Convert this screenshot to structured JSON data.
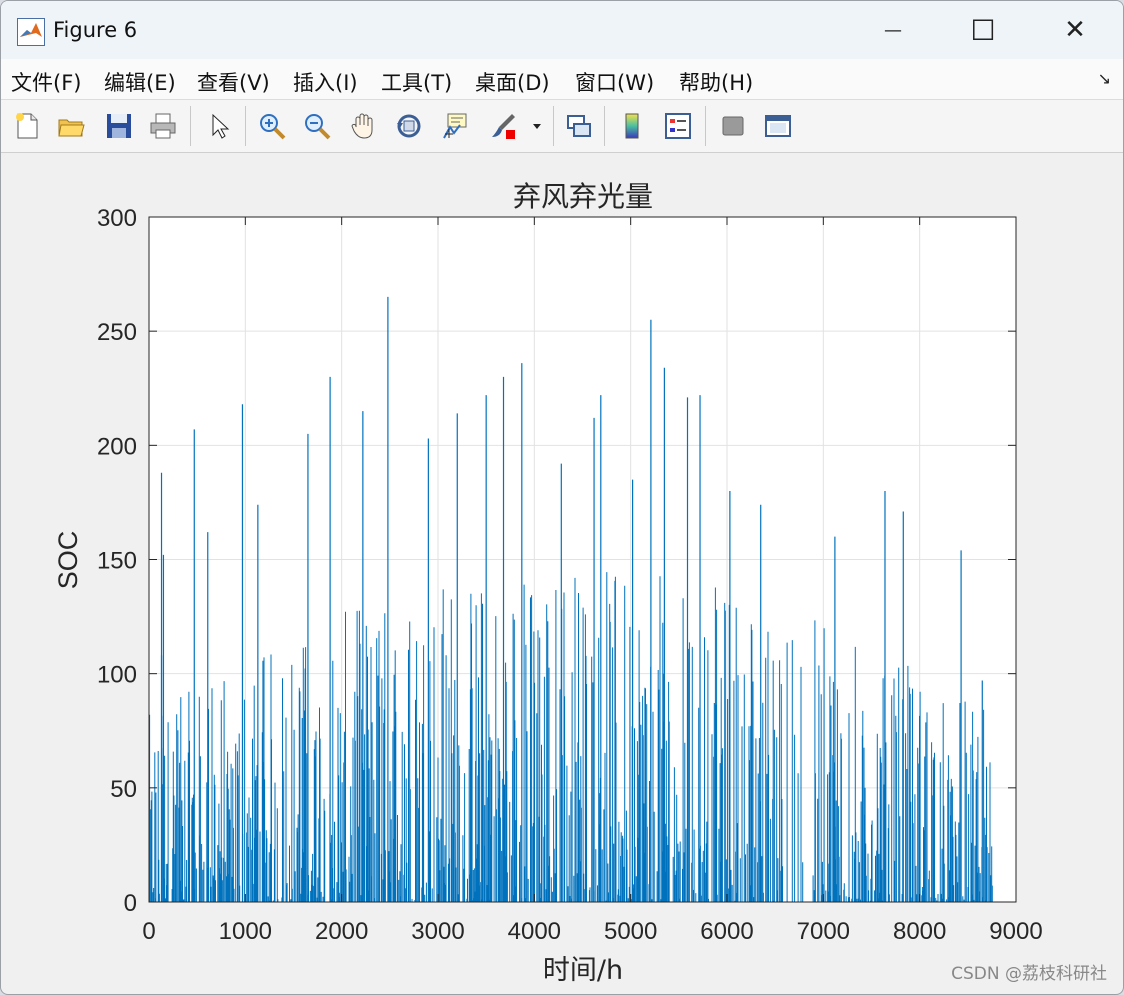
{
  "window": {
    "title": "Figure 6",
    "minimize_glyph": "—",
    "maximize_glyph": "☐",
    "close_glyph": "✕"
  },
  "menu": [
    {
      "label": "文件(F)"
    },
    {
      "label": "编辑(E)"
    },
    {
      "label": "查看(V)"
    },
    {
      "label": "插入(I)"
    },
    {
      "label": "工具(T)"
    },
    {
      "label": "桌面(D)"
    },
    {
      "label": "窗口(W)"
    },
    {
      "label": "帮助(H)"
    }
  ],
  "toolbar": {
    "icons": [
      "new-figure-icon",
      "open-folder-icon",
      "save-icon",
      "print-icon",
      "pointer-icon",
      "zoom-in-icon",
      "zoom-out-icon",
      "pan-hand-icon",
      "rotate-3d-icon",
      "data-cursor-icon",
      "brush-icon",
      "brush-dropdown-icon",
      "link-plot-icon",
      "colorbar-icon",
      "legend-icon",
      "hide-plot-tools-icon",
      "show-plot-tools-icon"
    ]
  },
  "colors": {
    "bar": "#0072BD",
    "grid": "#e2e2e2",
    "axes_bg": "#ffffff",
    "figure_bg": "#f0f0f0"
  },
  "watermark": "CSDN @荔枝科研社",
  "chart_data": {
    "type": "bar",
    "title": "弃风弃光量",
    "xlabel": "时间/h",
    "ylabel": "SOC",
    "xlim": [
      0,
      9000
    ],
    "ylim": [
      0,
      300
    ],
    "xticks": [
      0,
      1000,
      2000,
      3000,
      4000,
      5000,
      6000,
      7000,
      8000,
      9000
    ],
    "yticks": [
      0,
      50,
      100,
      150,
      200,
      250,
      300
    ],
    "grid": true,
    "n_points": 8760,
    "series": [
      {
        "color": "#0072BD",
        "peaks": [
          {
            "x": 130,
            "y": 108
          },
          {
            "x": 130,
            "y": 188
          },
          {
            "x": 150,
            "y": 152
          },
          {
            "x": 470,
            "y": 207
          },
          {
            "x": 610,
            "y": 162
          },
          {
            "x": 970,
            "y": 218
          },
          {
            "x": 1130,
            "y": 174
          },
          {
            "x": 1650,
            "y": 205
          },
          {
            "x": 1880,
            "y": 230
          },
          {
            "x": 2220,
            "y": 215
          },
          {
            "x": 2480,
            "y": 265
          },
          {
            "x": 2900,
            "y": 203
          },
          {
            "x": 3200,
            "y": 214
          },
          {
            "x": 3500,
            "y": 222
          },
          {
            "x": 3680,
            "y": 230
          },
          {
            "x": 3870,
            "y": 236
          },
          {
            "x": 4280,
            "y": 192
          },
          {
            "x": 4620,
            "y": 212
          },
          {
            "x": 4690,
            "y": 222
          },
          {
            "x": 5020,
            "y": 185
          },
          {
            "x": 5210,
            "y": 255
          },
          {
            "x": 5350,
            "y": 234
          },
          {
            "x": 5590,
            "y": 221
          },
          {
            "x": 5720,
            "y": 222
          },
          {
            "x": 6030,
            "y": 180
          },
          {
            "x": 6350,
            "y": 174
          },
          {
            "x": 7120,
            "y": 160
          },
          {
            "x": 7640,
            "y": 180
          },
          {
            "x": 7830,
            "y": 171
          },
          {
            "x": 8430,
            "y": 154
          },
          {
            "x": 8650,
            "y": 97
          }
        ],
        "last_x": 8760
      }
    ]
  }
}
